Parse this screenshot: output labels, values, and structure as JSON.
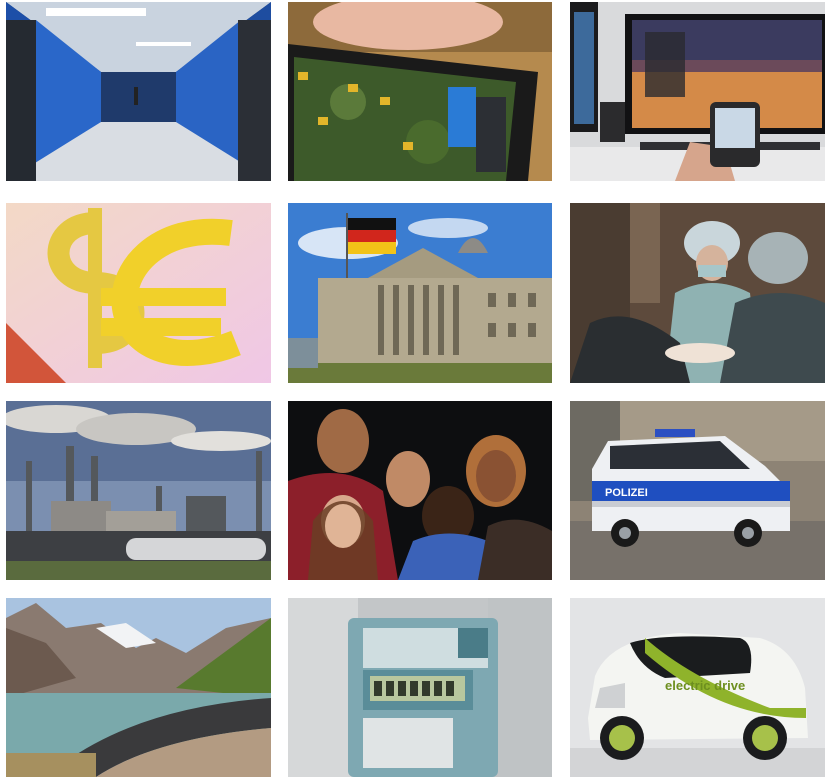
{
  "tiles": [
    {
      "id": "server-corridor",
      "subject": "data center corridor"
    },
    {
      "id": "tablet-map",
      "subject": "hand holding tablet with map"
    },
    {
      "id": "smart-tv-phone",
      "subject": "smartphone controlling TV"
    },
    {
      "id": "currency-symbols",
      "subject": "dollar and euro symbols"
    },
    {
      "id": "reichstag",
      "subject": "Reichstag building with German flag"
    },
    {
      "id": "surgeons",
      "subject": "surgeons in operating room"
    },
    {
      "id": "refinery",
      "subject": "industrial refinery with smoke"
    },
    {
      "id": "group-people",
      "subject": "group of smiling people"
    },
    {
      "id": "police-van",
      "subject": "police van"
    },
    {
      "id": "reservoir-dam",
      "subject": "mountain reservoir and dam"
    },
    {
      "id": "electric-meter",
      "subject": "electricity meter"
    },
    {
      "id": "electric-car",
      "subject": "smart car electric drive"
    }
  ],
  "texts": {
    "police_label": "POLIZEI",
    "car_label": "electric drive"
  }
}
